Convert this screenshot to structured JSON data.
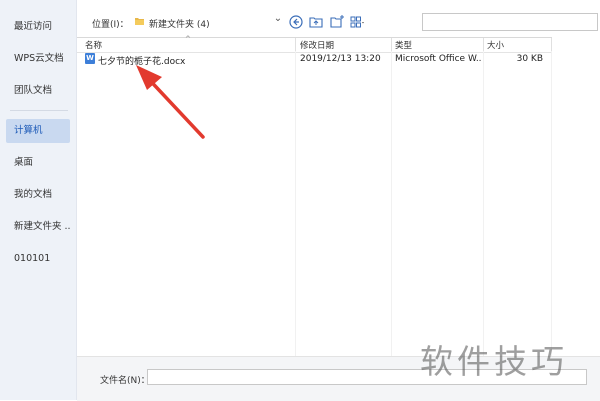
{
  "sidebar": {
    "items": [
      {
        "label": "最近访问"
      },
      {
        "label": "WPS云文档"
      },
      {
        "label": "团队文档"
      },
      {
        "label": "计算机"
      },
      {
        "label": "桌面"
      },
      {
        "label": "我的文档"
      },
      {
        "label": "新建文件夹 ..."
      },
      {
        "label": "010101"
      }
    ],
    "active_index": 3
  },
  "toolbar": {
    "location_label": "位置(I)：",
    "location_value": "新建文件夹 (4)",
    "dropdown_icon": "chevron-down-icon",
    "buttons": [
      "back-icon",
      "up-folder-icon",
      "new-folder-icon",
      "view-menu-icon"
    ]
  },
  "columns": {
    "name": "名称",
    "modified": "修改日期",
    "type": "类型",
    "size": "大小"
  },
  "files": [
    {
      "name": "七夕节的栀子花.docx",
      "modified": "2019/12/13 13:20",
      "type": "Microsoft Office W...",
      "size": "30 KB",
      "icon": "W"
    }
  ],
  "bottom": {
    "filename_label": "文件名(N)：",
    "filename_value": ""
  },
  "watermark": "软件技巧",
  "colors": {
    "accent": "#1e5bb8",
    "sidebar_bg": "#eef2f8",
    "active_bg": "#c9d9f0",
    "arrow": "#e23a2e",
    "doc_icon": "#3d7fd9"
  }
}
